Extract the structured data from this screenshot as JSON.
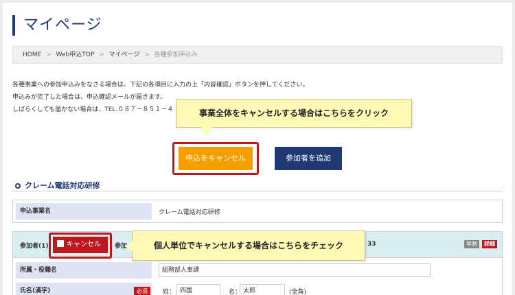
{
  "page": {
    "title": "マイページ"
  },
  "breadcrumb": {
    "items": [
      "HOME",
      "Web申込TOP",
      "マイページ"
    ],
    "current": "各種参加申込み",
    "separator": ">"
  },
  "intro": {
    "line1": "各種事業への参加申込みをなさる場合は、下記の各項目に入力の上「内容確認」ボタンを押してください。",
    "line2": "申込みが完了した場合は、申込確認メールが届きます。",
    "line3": "しばらくしても届かない場合は、TEL.０８７－８５１－４"
  },
  "callouts": {
    "top": "事業全体をキャンセルする場合はこちらをクリック",
    "middle": "個人単位でキャンセルする場合はこちらをチェック"
  },
  "buttons": {
    "cancel_all": "申込をキャンセル",
    "add_participant": "参加者を追加"
  },
  "section": {
    "title": "クレーム電話対応研修"
  },
  "event": {
    "label": "申込事業名",
    "value": "クレーム電話対応研修"
  },
  "participant": {
    "label": "参加者(1)",
    "cancel_label": "キャンセル",
    "label2": "参加",
    "time_fragment": "33",
    "tag_early": "早割",
    "tag_detail": "詳細"
  },
  "form": {
    "dept": {
      "label": "所属・役職名",
      "value": "総務部人事課"
    },
    "name": {
      "label": "氏名(漢字)",
      "required": "必須",
      "sei_label": "姓：",
      "sei_value": "四国",
      "mei_label": "名：",
      "mei_value": "太郎",
      "note": "(全角)"
    }
  },
  "colors": {
    "brand_navy": "#1f3a73",
    "accent_orange": "#f5a000",
    "highlight_red": "#c0171f",
    "callout_yellow": "#fffbb6"
  }
}
